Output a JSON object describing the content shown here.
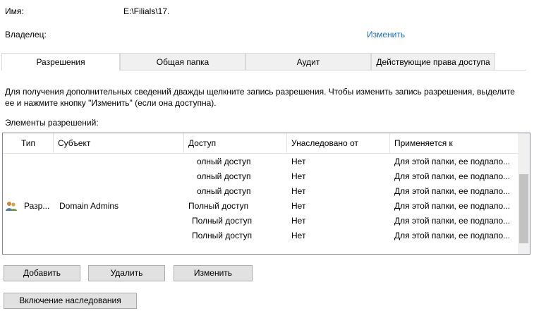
{
  "header": {
    "name_label": "Имя:",
    "name_value": "E:\\Filials\\17.",
    "owner_label": "Владелец:",
    "owner_change_link": "Изменить"
  },
  "tabs": [
    {
      "label": "Разрешения",
      "active": true
    },
    {
      "label": "Общая папка",
      "active": false
    },
    {
      "label": "Аудит",
      "active": false
    },
    {
      "label": "Действующие права доступа",
      "active": false
    }
  ],
  "info_text_line1": "Для получения дополнительных сведений дважды щелкните запись разрешения. Чтобы изменить запись разрешения, выделите",
  "info_text_line2": "ее и нажмите кнопку \"Изменить\" (если она доступна).",
  "permissions_label": "Элементы разрешений:",
  "table": {
    "columns": [
      "Тип",
      "Субъект",
      "Доступ",
      "Унаследовано от",
      "Применяется к"
    ],
    "rows": [
      {
        "type": "",
        "subject": "",
        "access": "олный доступ",
        "inherited": "Нет",
        "applies": "Для этой папки, ее подпапо..."
      },
      {
        "type": "",
        "subject": "",
        "access": "олный доступ",
        "inherited": "Нет",
        "applies": "Для этой папки, ее подпапо..."
      },
      {
        "type": "",
        "subject": "",
        "access": "олный доступ",
        "inherited": "Нет",
        "applies": "Для этой папки, ее подпапо..."
      },
      {
        "type": "Разр...",
        "subject": "Domain Admins",
        "access": "Полный доступ",
        "inherited": "Нет",
        "applies": "Для этой папки, ее подпапо..."
      },
      {
        "type": "",
        "subject": "",
        "access": "Полный доступ",
        "inherited": "Нет",
        "applies": "Для этой папки, ее подпапо..."
      },
      {
        "type": "",
        "subject": "",
        "access": "Полный доступ",
        "inherited": "Нет",
        "applies": "Для этой папки, ее подпапо..."
      }
    ]
  },
  "buttons": {
    "add": "Добавить",
    "remove": "Удалить",
    "edit": "Изменить",
    "enable_inheritance": "Включение наследования"
  },
  "icons": {
    "group": "users-icon"
  }
}
